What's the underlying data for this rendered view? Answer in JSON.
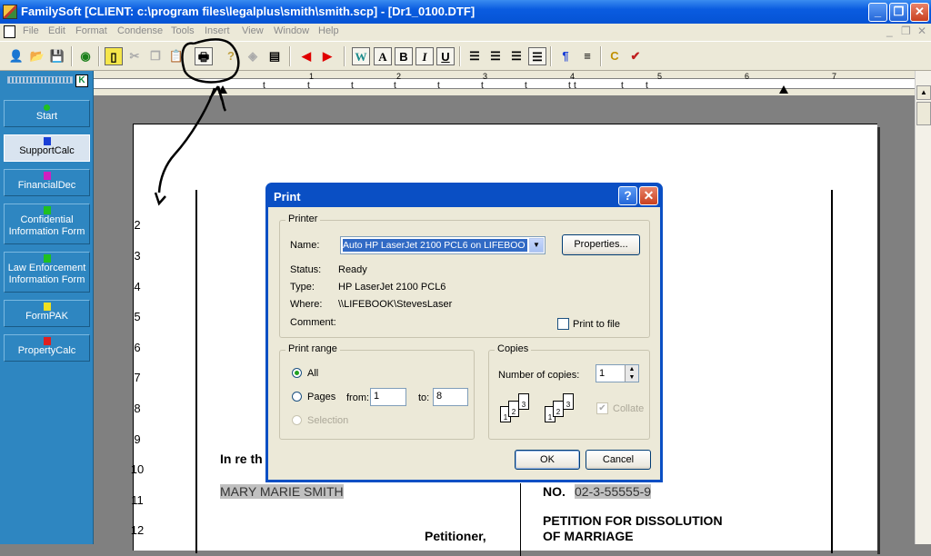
{
  "window": {
    "title": "FamilySoft  [CLIENT: c:\\program files\\legalplus\\smith\\smith.scp] - [Dr1_0100.DTF]",
    "minimize": "_",
    "restore": "❐",
    "close": "✕"
  },
  "menu": {
    "items": [
      "File",
      "Edit",
      "Format",
      "Condense",
      "Tools",
      "Insert",
      "View",
      "Window",
      "Help"
    ],
    "mdi_min": "_",
    "mdi_restore": "❐",
    "mdi_close": "✕"
  },
  "toolbar": {
    "format_w": "W",
    "format_a": "A",
    "bold": "B",
    "italic": "I",
    "underline": "U"
  },
  "ruler": {
    "numbers": [
      "1",
      "2",
      "3",
      "4",
      "5",
      "6",
      "7"
    ],
    "tab_glyph": "t"
  },
  "sidebar": {
    "items": [
      {
        "label": "Start",
        "icon_color": "#20c020"
      },
      {
        "label": "SupportCalc",
        "icon_color": "#1a3fd6"
      },
      {
        "label": "FinancialDec",
        "icon_color": "#d020c0"
      },
      {
        "label": "Confidential Information Form",
        "icon_color": "#20c020"
      },
      {
        "label": "Law Enforcement Information Form",
        "icon_color": "#20c020"
      },
      {
        "label": "FormPAK",
        "icon_color": "#f0e020"
      },
      {
        "label": "PropertyCalc",
        "icon_color": "#e02020"
      }
    ],
    "collapse_glyph": "K"
  },
  "document": {
    "line_numbers": [
      "2",
      "3",
      "4",
      "5",
      "6",
      "7",
      "8",
      "9",
      "10",
      "11",
      "12"
    ],
    "in_re": "In re th",
    "party": "MARY MARIE SMITH",
    "role": "Petitioner,",
    "no_label": "NO.",
    "case_no": "02-3-55555-9",
    "heading_1": "PETITION FOR DISSOLUTION",
    "heading_2": "OF MARRIAGE"
  },
  "dialog": {
    "title": "Print",
    "help": "?",
    "close": "✕",
    "printer": {
      "legend": "Printer",
      "name_label": "Name:",
      "name_value": "Auto HP LaserJet 2100 PCL6 on LIFEBOO",
      "properties": "Properties...",
      "status_label": "Status:",
      "status_value": "Ready",
      "type_label": "Type:",
      "type_value": "HP LaserJet 2100 PCL6",
      "where_label": "Where:",
      "where_value": "\\\\LIFEBOOK\\StevesLaser",
      "comment_label": "Comment:",
      "print_to_file": "Print to file"
    },
    "range": {
      "legend": "Print range",
      "all": "All",
      "pages": "Pages",
      "from_label": "from:",
      "from_value": "1",
      "to_label": "to:",
      "to_value": "8",
      "selection": "Selection"
    },
    "copies": {
      "legend": "Copies",
      "number_label": "Number of copies:",
      "number_value": "1",
      "collate": "Collate"
    },
    "ok": "OK",
    "cancel": "Cancel"
  }
}
